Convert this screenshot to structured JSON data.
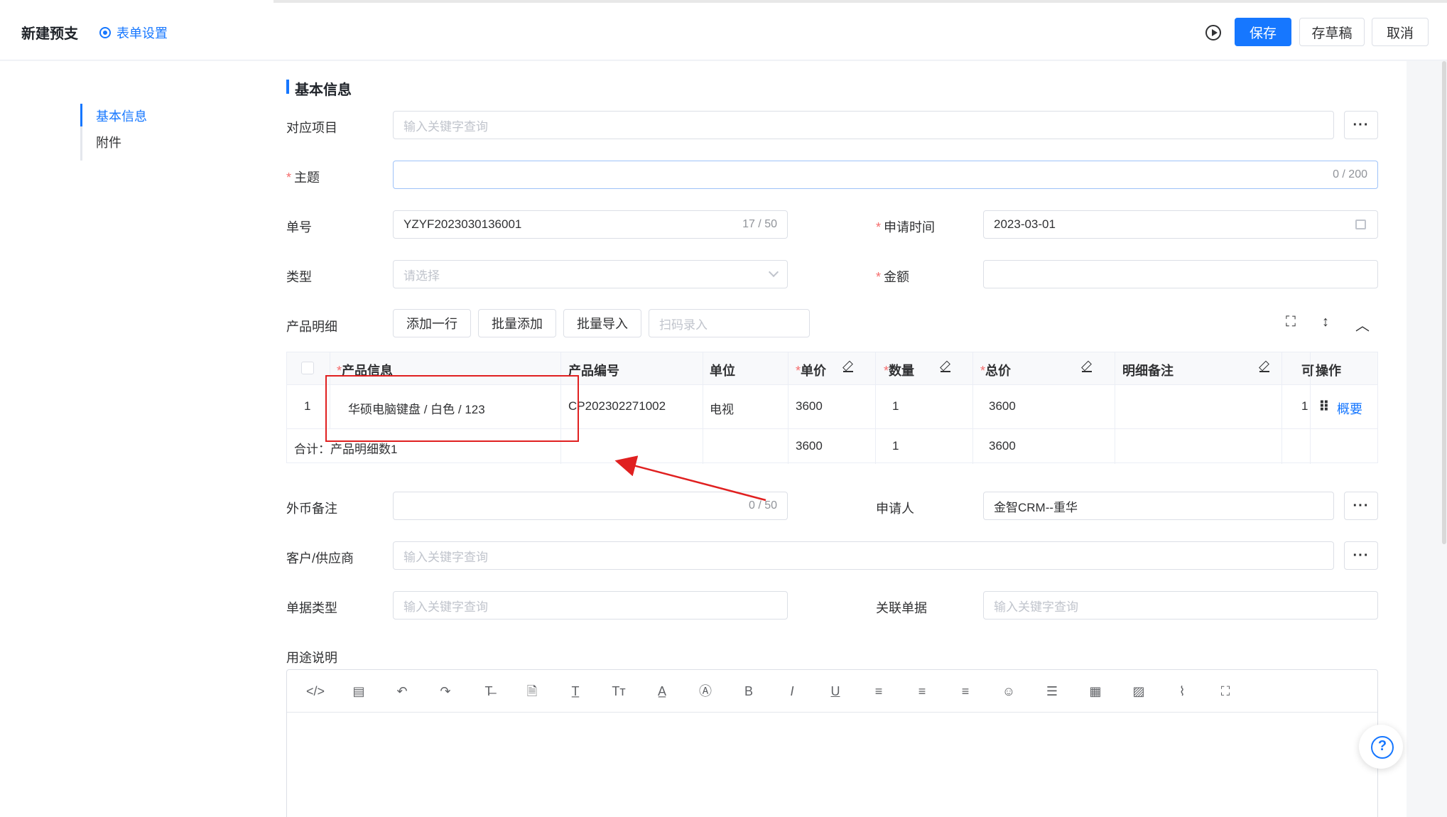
{
  "header": {
    "title": "新建预支",
    "form_settings": "表单设置",
    "save": "保存",
    "draft": "存草稿",
    "cancel": "取消"
  },
  "sidebar": {
    "items": [
      {
        "label": "基本信息",
        "active": true
      },
      {
        "label": "附件",
        "active": false
      }
    ]
  },
  "section": {
    "title": "基本信息"
  },
  "form": {
    "project": {
      "label": "对应项目",
      "placeholder": "输入关键字查询"
    },
    "subject": {
      "label": "主题",
      "value": "",
      "counter": "0 / 200"
    },
    "order_no": {
      "label": "单号",
      "value": "YZYF2023030136001",
      "counter": "17 / 50"
    },
    "apply_time": {
      "label": "申请时间",
      "value": "2023-03-01"
    },
    "type": {
      "label": "类型",
      "placeholder": "请选择"
    },
    "amount": {
      "label": "金额",
      "value": ""
    },
    "product_detail": {
      "label": "产品明细",
      "add_row": "添加一行",
      "batch_add": "批量添加",
      "batch_import": "批量导入",
      "scan_placeholder": "扫码录入"
    },
    "foreign_note": {
      "label": "外币备注",
      "counter": "0 / 50"
    },
    "applicant": {
      "label": "申请人",
      "value": "金智CRM--重华"
    },
    "customer": {
      "label": "客户/供应商",
      "placeholder": "输入关键字查询"
    },
    "doc_type": {
      "label": "单据类型",
      "placeholder": "输入关键字查询"
    },
    "related_doc": {
      "label": "关联单据",
      "placeholder": "输入关键字查询"
    },
    "usage": {
      "label": "用途说明"
    }
  },
  "table": {
    "headers": {
      "product_info": "产品信息",
      "product_code": "产品编号",
      "unit": "单位",
      "price": "单价",
      "qty": "数量",
      "total": "总价",
      "remark": "明细备注",
      "extra": "可",
      "action": "操作"
    },
    "rows": [
      {
        "index": "1",
        "product_info": "华硕电脑键盘 / 白色 / 123",
        "product_code": "CP202302271002",
        "unit": "电视",
        "price": "3600",
        "qty": "1",
        "total": "3600",
        "remark": "",
        "extra": "1",
        "action": "概要"
      }
    ],
    "summary": {
      "label": "合计：产品明细数1",
      "price": "3600",
      "qty": "1",
      "total": "3600"
    }
  },
  "editor": {
    "tools": [
      "code-icon",
      "template-icon",
      "undo-icon",
      "redo-icon",
      "strikethrough-icon",
      "document-icon",
      "text-icon",
      "font-size-icon",
      "font-color-icon",
      "background-color-icon",
      "bold-icon",
      "italic-icon",
      "underline-icon",
      "align-left-icon",
      "align-center-icon",
      "align-right-icon",
      "emoji-icon",
      "line-height-icon",
      "table-icon",
      "image-icon",
      "attachment-icon",
      "fullscreen-icon"
    ]
  },
  "colors": {
    "accent": "#1677ff",
    "required": "#f56c6c",
    "annotation": "#e02020"
  }
}
